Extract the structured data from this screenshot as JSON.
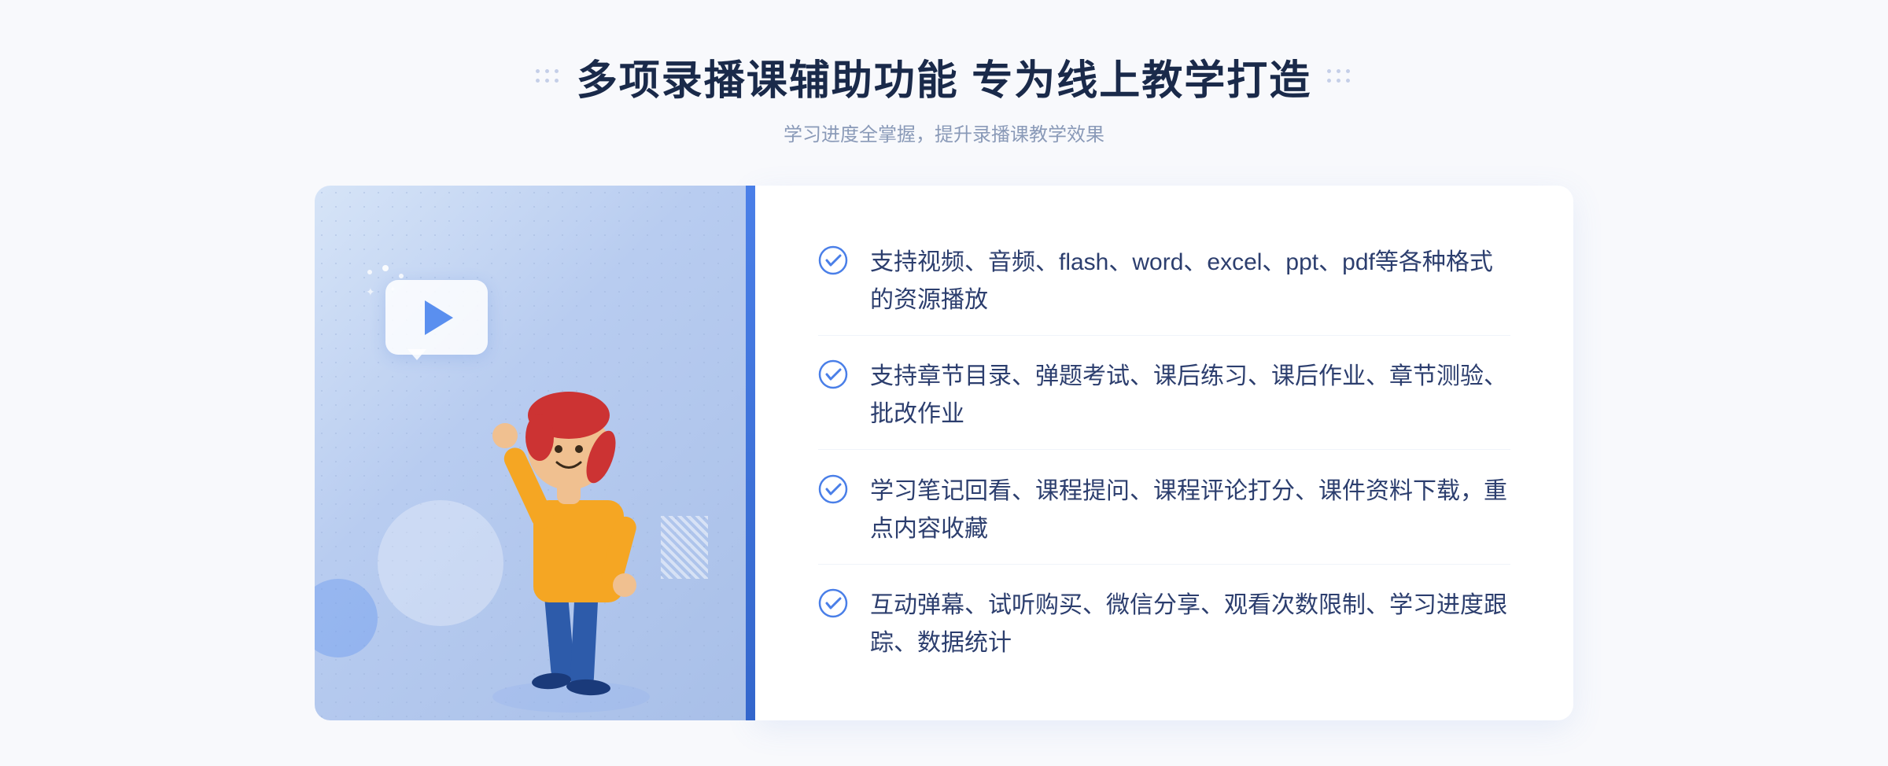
{
  "header": {
    "main_title": "多项录播课辅助功能 专为线上教学打造",
    "subtitle": "学习进度全掌握，提升录播课教学效果"
  },
  "features": [
    {
      "id": "feature-1",
      "text": "支持视频、音频、flash、word、excel、ppt、pdf等各种格式的资源播放"
    },
    {
      "id": "feature-2",
      "text": "支持章节目录、弹题考试、课后练习、课后作业、章节测验、批改作业"
    },
    {
      "id": "feature-3",
      "text": "学习笔记回看、课程提问、课程评论打分、课件资料下载，重点内容收藏"
    },
    {
      "id": "feature-4",
      "text": "互动弹幕、试听购买、微信分享、观看次数限制、学习进度跟踪、数据统计"
    }
  ],
  "decorative": {
    "arrows_symbol": "»",
    "check_color": "#4a7fe8",
    "accent_color": "#4a7fe8"
  }
}
